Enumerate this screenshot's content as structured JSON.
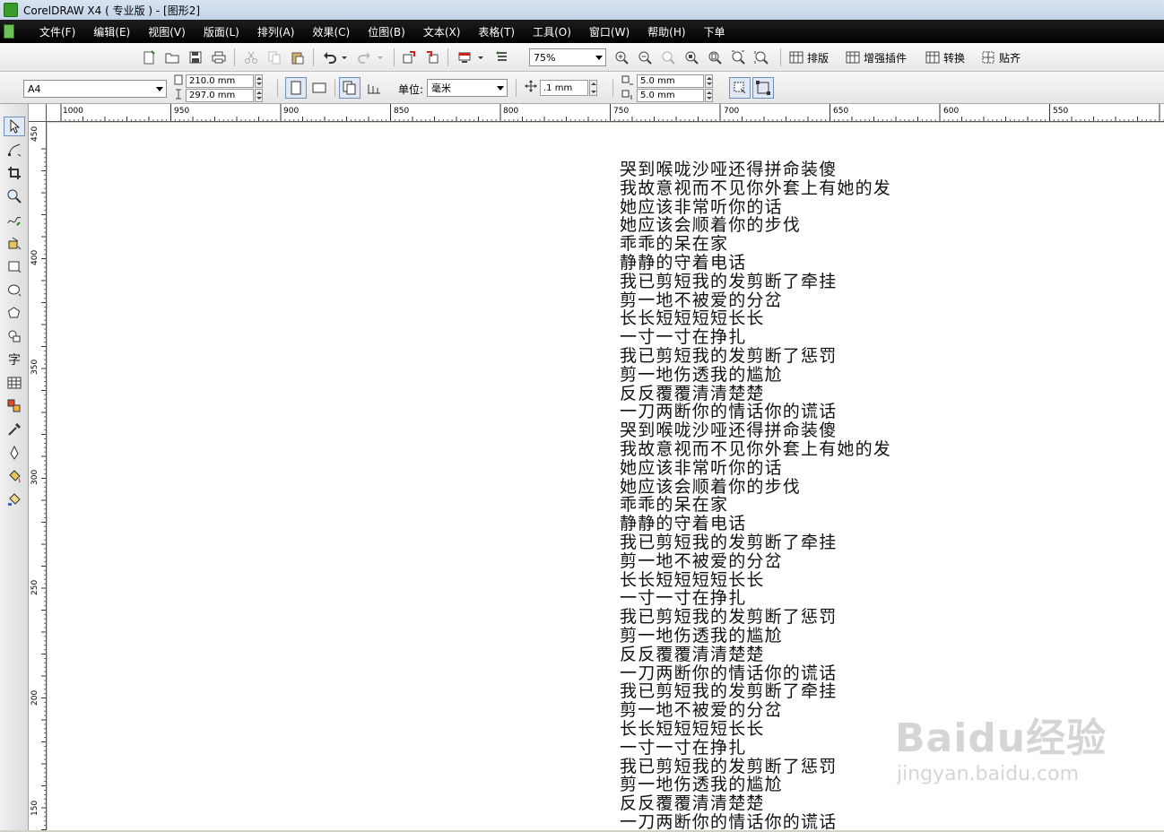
{
  "window": {
    "title": "CorelDRAW X4 ( 专业版 ) - [图形2]"
  },
  "menu": [
    "文件(F)",
    "编辑(E)",
    "视图(V)",
    "版面(L)",
    "排列(A)",
    "效果(C)",
    "位图(B)",
    "文本(X)",
    "表格(T)",
    "工具(O)",
    "窗口(W)",
    "帮助(H)",
    "下单"
  ],
  "toolbar": {
    "zoom_value": "75%",
    "buttons": [
      "排版",
      "增强插件",
      "转换",
      "贴齐"
    ]
  },
  "property_bar": {
    "page_size": "A4",
    "width": "210.0 mm",
    "height": "297.0 mm",
    "units_label": "单位:",
    "units_value": "毫米",
    "nudge": ".1 mm",
    "dup_x": "5.0 mm",
    "dup_y": "5.0 mm"
  },
  "rulers": {
    "horizontal": [
      "1000",
      "950",
      "900",
      "850",
      "800",
      "750",
      "700",
      "650",
      "600",
      "550"
    ],
    "vertical": [
      "450",
      "400",
      "350",
      "300",
      "250",
      "200",
      "150"
    ]
  },
  "lyrics": [
    "哭到喉咙沙哑还得拼命装傻",
    "我故意视而不见你外套上有她的发",
    "她应该非常听你的话",
    "她应该会顺着你的步伐",
    "乖乖的呆在家",
    "静静的守着电话",
    "我已剪短我的发剪断了牵挂",
    "剪一地不被爱的分岔",
    "长长短短短短长长",
    "一寸一寸在挣扎",
    "我已剪短我的发剪断了惩罚",
    "剪一地伤透我的尴尬",
    "反反覆覆清清楚楚",
    "一刀两断你的情话你的谎话",
    "哭到喉咙沙哑还得拼命装傻",
    "我故意视而不见你外套上有她的发",
    "她应该非常听你的话",
    "她应该会顺着你的步伐",
    "乖乖的呆在家",
    "静静的守着电话",
    "我已剪短我的发剪断了牵挂",
    "剪一地不被爱的分岔",
    "长长短短短短长长",
    "一寸一寸在挣扎",
    "我已剪短我的发剪断了惩罚",
    "剪一地伤透我的尴尬",
    "反反覆覆清清楚楚",
    "一刀两断你的情话你的谎话",
    "我已剪短我的发剪断了牵挂",
    "剪一地不被爱的分岔",
    "长长短短短短长长",
    "一寸一寸在挣扎",
    "我已剪短我的发剪断了惩罚",
    "剪一地伤透我的尴尬",
    "反反覆覆清清楚楚",
    "一刀两断你的情话你的谎话"
  ],
  "watermark": {
    "main": "Baidu经验",
    "sub": "jingyan.baidu.com"
  }
}
